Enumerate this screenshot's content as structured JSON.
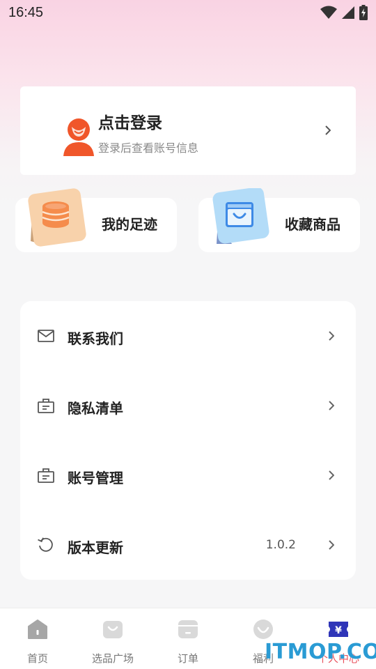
{
  "status": {
    "time": "16:45"
  },
  "login": {
    "title": "点击登录",
    "subtitle": "登录后查看账号信息"
  },
  "tiles": [
    {
      "label": "我的足迹",
      "icon": "coin-stack-icon"
    },
    {
      "label": "收藏商品",
      "icon": "shopping-bag-icon"
    }
  ],
  "menu": [
    {
      "label": "联系我们",
      "icon": "envelope-icon",
      "value": ""
    },
    {
      "label": "隐私清单",
      "icon": "briefcase-icon",
      "value": ""
    },
    {
      "label": "账号管理",
      "icon": "briefcase-icon",
      "value": ""
    },
    {
      "label": "版本更新",
      "icon": "refresh-icon",
      "value": "1.0.2"
    }
  ],
  "nav": [
    {
      "label": "首页",
      "icon": "home-icon",
      "active": false
    },
    {
      "label": "选品广场",
      "icon": "bag-icon",
      "active": false
    },
    {
      "label": "订单",
      "icon": "order-icon",
      "active": false
    },
    {
      "label": "福利",
      "icon": "smile-icon",
      "active": false
    },
    {
      "label": "个人中心",
      "icon": "yuan-ticket-icon",
      "active": true
    }
  ],
  "watermark": {
    "text": "ITMOP.COM"
  },
  "colors": {
    "accent": "#e8505b",
    "avatar_orange": "#f0562a",
    "tile_orange": "#f7c89a",
    "tile_blue": "#a9d4f5"
  }
}
